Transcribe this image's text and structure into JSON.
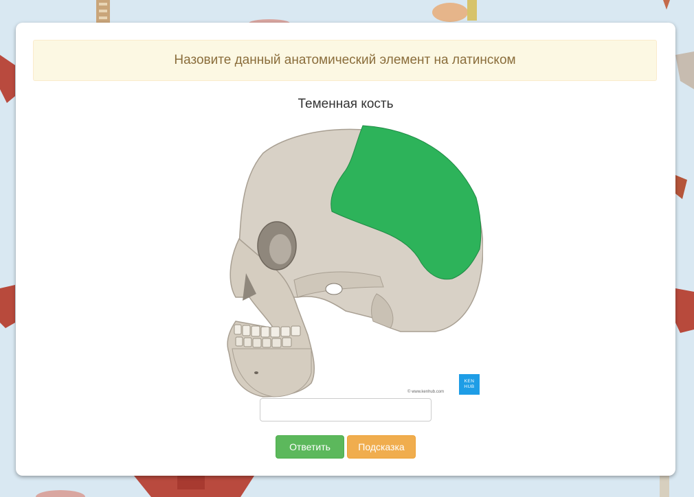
{
  "quiz": {
    "prompt": "Назовите данный анатомический элемент на латинском",
    "term": "Теменная кость",
    "answer_value": "",
    "answer_placeholder": "",
    "answer_button": "Ответить",
    "hint_button": "Подсказка"
  },
  "figure": {
    "image_subject": "skull-lateral-parietal-highlighted",
    "highlight_color": "#2db35a",
    "bone_color": "#d8d1c6",
    "logo_top": "KEN",
    "logo_bottom": "HUB",
    "copyright": "© www.kenhub.com"
  },
  "colors": {
    "background": "#d9e8f2",
    "prompt_bg": "#fcf8e3",
    "prompt_text": "#8a6d3b",
    "answer_button": "#5cb85c",
    "hint_button": "#f0ad4e",
    "logo": "#1e9de6"
  }
}
